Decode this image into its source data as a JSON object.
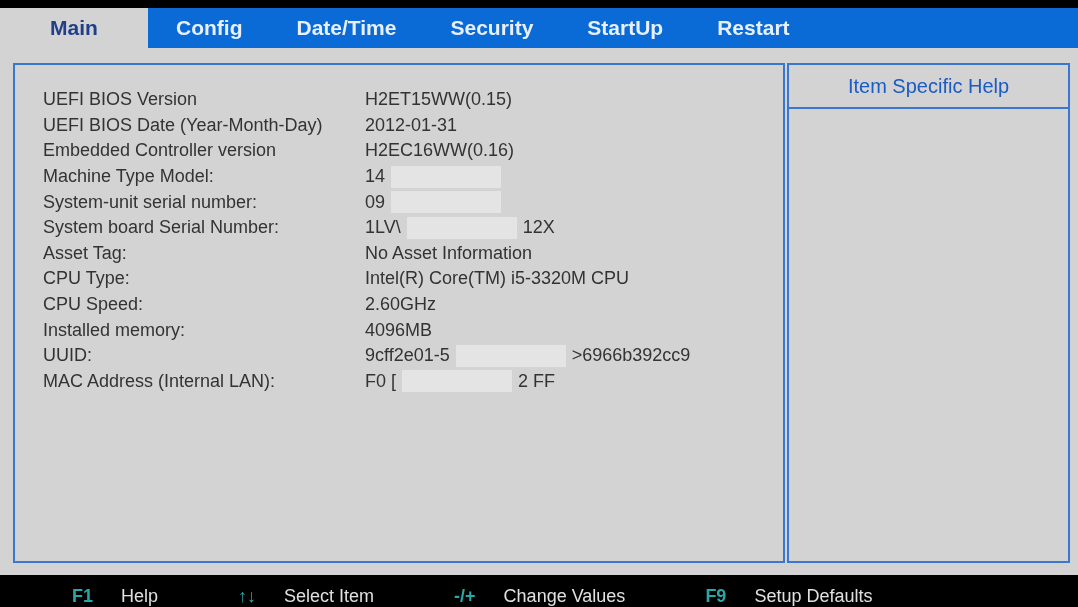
{
  "tabs": [
    {
      "label": "Main",
      "selected": true
    },
    {
      "label": "Config",
      "selected": false
    },
    {
      "label": "Date/Time",
      "selected": false
    },
    {
      "label": "Security",
      "selected": false
    },
    {
      "label": "StartUp",
      "selected": false
    },
    {
      "label": "Restart",
      "selected": false
    }
  ],
  "info_rows": [
    {
      "label": "UEFI BIOS Version",
      "value_parts": [
        "H2ET15WW(0.15)"
      ],
      "redacted": false
    },
    {
      "label": "UEFI BIOS Date (Year-Month-Day)",
      "value_parts": [
        "2012-01-31"
      ],
      "redacted": false
    },
    {
      "label": "Embedded Controller version",
      "value_parts": [
        "H2EC16WW(0.16)"
      ],
      "redacted": false
    },
    {
      "label": "Machine Type Model:",
      "value_parts": [
        "14"
      ],
      "redacted": true
    },
    {
      "label": "System-unit serial number:",
      "value_parts": [
        "09"
      ],
      "redacted": true
    },
    {
      "label": "System board Serial Number:",
      "value_parts": [
        "1LV\\",
        "12X"
      ],
      "redacted": true
    },
    {
      "label": "Asset Tag:",
      "value_parts": [
        "No Asset Information"
      ],
      "redacted": false
    },
    {
      "label": "CPU Type:",
      "value_parts": [
        "Intel(R) Core(TM) i5-3320M CPU"
      ],
      "redacted": false
    },
    {
      "label": "CPU Speed:",
      "value_parts": [
        "2.60GHz"
      ],
      "redacted": false
    },
    {
      "label": "Installed memory:",
      "value_parts": [
        "4096MB"
      ],
      "redacted": false
    },
    {
      "label": "UUID:",
      "value_parts": [
        "9cff2e01-5",
        ">6966b392cc9"
      ],
      "redacted": true
    },
    {
      "label": "MAC Address (Internal LAN):",
      "value_parts": [
        "F0 [",
        "2 FF"
      ],
      "redacted": true
    }
  ],
  "help_panel": {
    "title": "Item Specific Help"
  },
  "footer_keys": [
    {
      "key": "F1",
      "action": "Help"
    },
    {
      "key": "↑↓",
      "action": "Select Item"
    },
    {
      "key": "-/+",
      "action": "Change Values"
    },
    {
      "key": "F9",
      "action": "Setup Defaults"
    }
  ]
}
